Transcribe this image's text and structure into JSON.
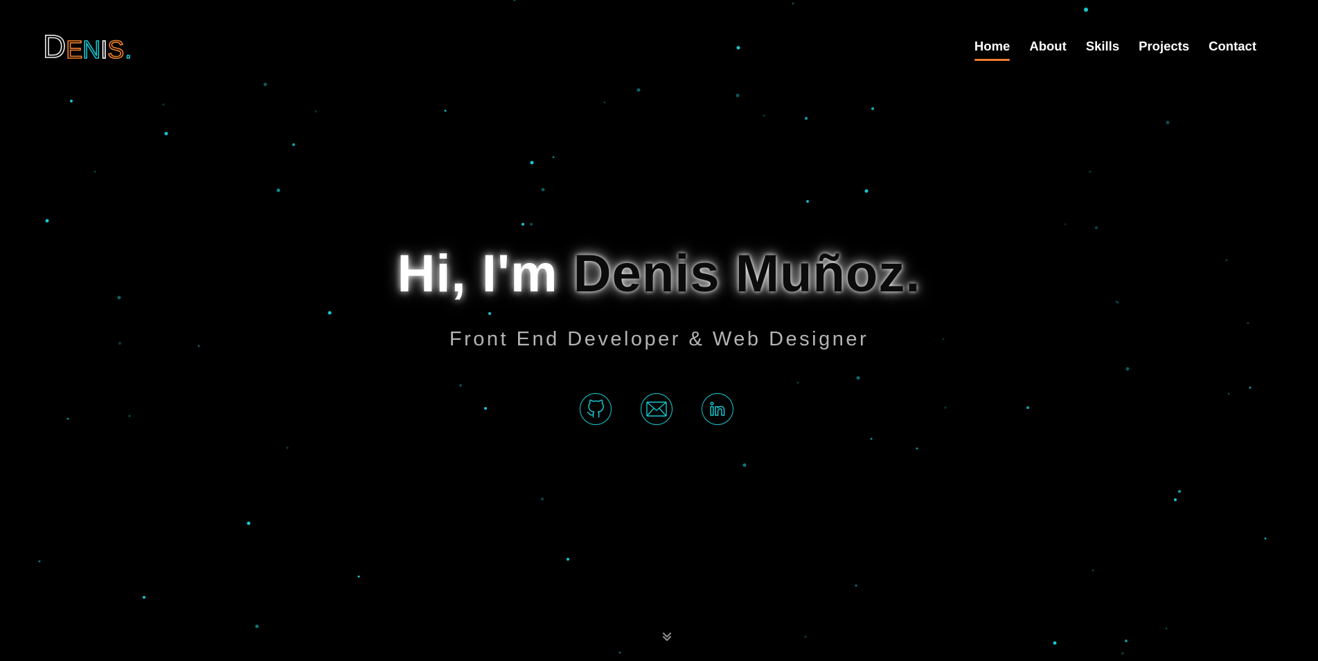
{
  "logo": {
    "letters": [
      {
        "char": "D",
        "color": "#e8e8e8",
        "size": "big"
      },
      {
        "char": "E",
        "color": "#f0802d",
        "size": "small"
      },
      {
        "char": "N",
        "color": "#16c7d1",
        "size": "small"
      },
      {
        "char": "I",
        "color": "#ffffff",
        "size": "small"
      },
      {
        "char": "S",
        "color": "#f0802d",
        "size": "small"
      },
      {
        "char": ".",
        "color": "#16c7d1",
        "size": "small"
      }
    ]
  },
  "nav": {
    "items": [
      {
        "label": "Home",
        "active": true
      },
      {
        "label": "About",
        "active": false
      },
      {
        "label": "Skills",
        "active": false
      },
      {
        "label": "Projects",
        "active": false
      },
      {
        "label": "Contact",
        "active": false
      }
    ]
  },
  "hero": {
    "greeting": "Hi, I'm",
    "name": "Denis Muñoz.",
    "subtitle": "Front End Developer & Web Designer"
  },
  "socials": [
    {
      "icon": "github-icon"
    },
    {
      "icon": "mail-icon"
    },
    {
      "icon": "linkedin-icon"
    }
  ],
  "scroll": {
    "icon": "chevron-double-down-icon"
  },
  "colors": {
    "background": "#000000",
    "accent": "#16c7d1",
    "nav_underline": "#f0802d",
    "subtitle": "#b4b4b4",
    "star": "#16c7d1"
  }
}
